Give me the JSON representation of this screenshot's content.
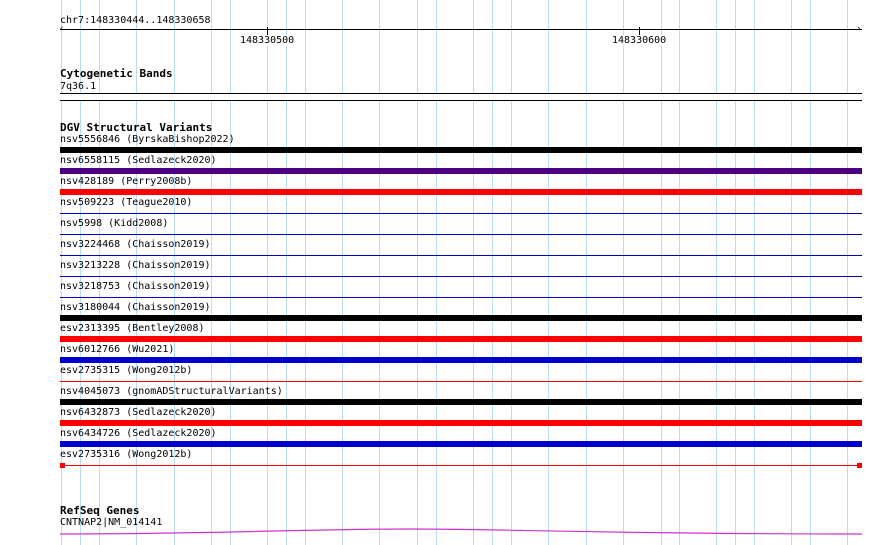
{
  "header": {
    "range_label": "chr7:148330444..148330658",
    "ticks": [
      {
        "label": "148330500"
      },
      {
        "label": "148330600"
      }
    ]
  },
  "cytoband_track": {
    "title": "Cytogenetic Bands",
    "band": "7q36.1"
  },
  "dgv_track": {
    "title": "DGV Structural Variants",
    "variants": [
      {
        "label": "nsv5556846 (ByrskaBishop2022)",
        "color": "#000000",
        "style": "thick"
      },
      {
        "label": "nsv6558115 (Sedlazeck2020)",
        "color": "#4b0082",
        "style": "thick"
      },
      {
        "label": "nsv428189 (Perry2008b)",
        "color": "#ff0000",
        "style": "thick"
      },
      {
        "label": "nsv509223 (Teague2010)",
        "color": "#0000cc",
        "style": "thin"
      },
      {
        "label": "nsv5998 (Kidd2008)",
        "color": "#0000cc",
        "style": "thin"
      },
      {
        "label": "nsv3224468 (Chaisson2019)",
        "color": "#0000cc",
        "style": "thin"
      },
      {
        "label": "nsv3213228 (Chaisson2019)",
        "color": "#0000cc",
        "style": "thin"
      },
      {
        "label": "nsv3218753 (Chaisson2019)",
        "color": "#0000cc",
        "style": "thin"
      },
      {
        "label": "nsv3180044 (Chaisson2019)",
        "color": "#000000",
        "style": "thick"
      },
      {
        "label": "esv2313395 (Bentley2008)",
        "color": "#ff0000",
        "style": "thick"
      },
      {
        "label": "nsv6012766 (Wu2021)",
        "color": "#0000cc",
        "style": "thick"
      },
      {
        "label": "esv2735315 (Wong2012b)",
        "color": "#ff0000",
        "style": "thin"
      },
      {
        "label": "nsv4045073 (gnomADStructuralVariants)",
        "color": "#000000",
        "style": "thick"
      },
      {
        "label": "nsv6432873 (Sedlazeck2020)",
        "color": "#ff0000",
        "style": "thick"
      },
      {
        "label": "nsv6434726 (Sedlazeck2020)",
        "color": "#0000cc",
        "style": "thick"
      },
      {
        "label": "esv2735316 (Wong2012b)",
        "color": "#ff0000",
        "style": "thin-capped"
      }
    ]
  },
  "refseq_track": {
    "title": "RefSeq Genes",
    "gene_label": "CNTNAP2|NM_014141",
    "color": "#cc33cc"
  }
}
